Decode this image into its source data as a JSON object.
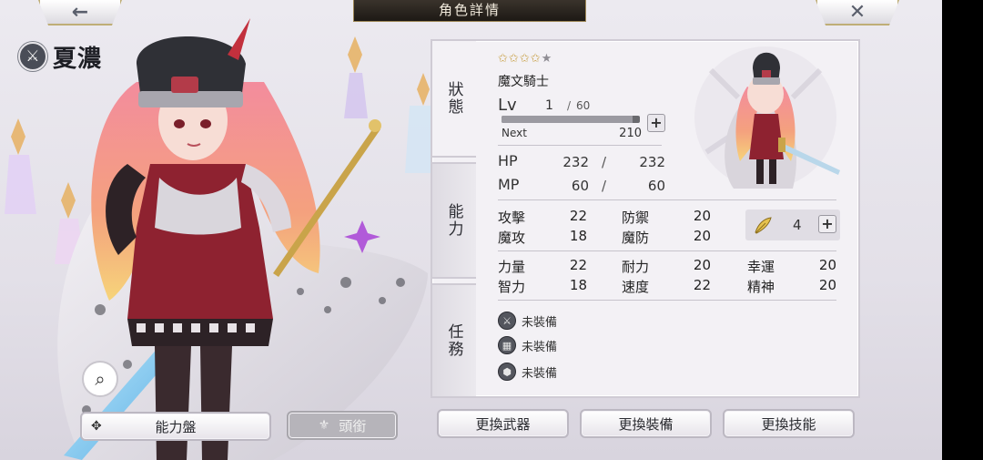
{
  "header": {
    "title": "角色詳情",
    "back_icon": "←",
    "close_icon": "✕"
  },
  "character": {
    "name": "夏濃",
    "badge_icon": "⚔"
  },
  "tabs": [
    {
      "label": "狀態"
    },
    {
      "label": "能力"
    },
    {
      "label": "任務"
    }
  ],
  "status": {
    "stars": {
      "filled": 4,
      "total": 5
    },
    "job": "魔文騎士",
    "lv_label": "Lv",
    "lv": "1",
    "lv_sep": "/",
    "lv_max": "60",
    "exp_progress": 0.95,
    "next_label": "Next",
    "next_value": "210",
    "hp_label": "HP",
    "hp_current": "232",
    "hp_max": "232",
    "mp_label": "MP",
    "mp_current": "60",
    "mp_max": "60",
    "slash": "/"
  },
  "combat_stats": [
    {
      "label": "攻擊",
      "value": "22"
    },
    {
      "label": "防禦",
      "value": "20"
    },
    {
      "label": "魔攻",
      "value": "18"
    },
    {
      "label": "魔防",
      "value": "20"
    }
  ],
  "feather": {
    "count": "4"
  },
  "base_stats": [
    {
      "label": "力量",
      "value": "22"
    },
    {
      "label": "耐力",
      "value": "20"
    },
    {
      "label": "幸運",
      "value": "20"
    },
    {
      "label": "智力",
      "value": "18"
    },
    {
      "label": "速度",
      "value": "22"
    },
    {
      "label": "精神",
      "value": "20"
    }
  ],
  "equipment": [
    {
      "icon": "weapon-icon",
      "glyph": "⚔",
      "label": "未裝備"
    },
    {
      "icon": "armor-icon",
      "glyph": "▦",
      "label": "未裝備"
    },
    {
      "icon": "accessory-icon",
      "glyph": "⬢",
      "label": "未裝備"
    }
  ],
  "buttons": {
    "ability_board": "能力盤",
    "title": "頭銜",
    "change_weapon": "更換武器",
    "change_equip": "更換裝備",
    "change_skill": "更換技能",
    "plus": "+",
    "zoom_icon": "⌕"
  },
  "colors": {
    "accent_gold": "#bfae76",
    "title_bar": "#1d1915",
    "panel_bg": "#f3f1f5",
    "outfit_red": "#8e2230",
    "hair_pink": "#f08a9c"
  }
}
